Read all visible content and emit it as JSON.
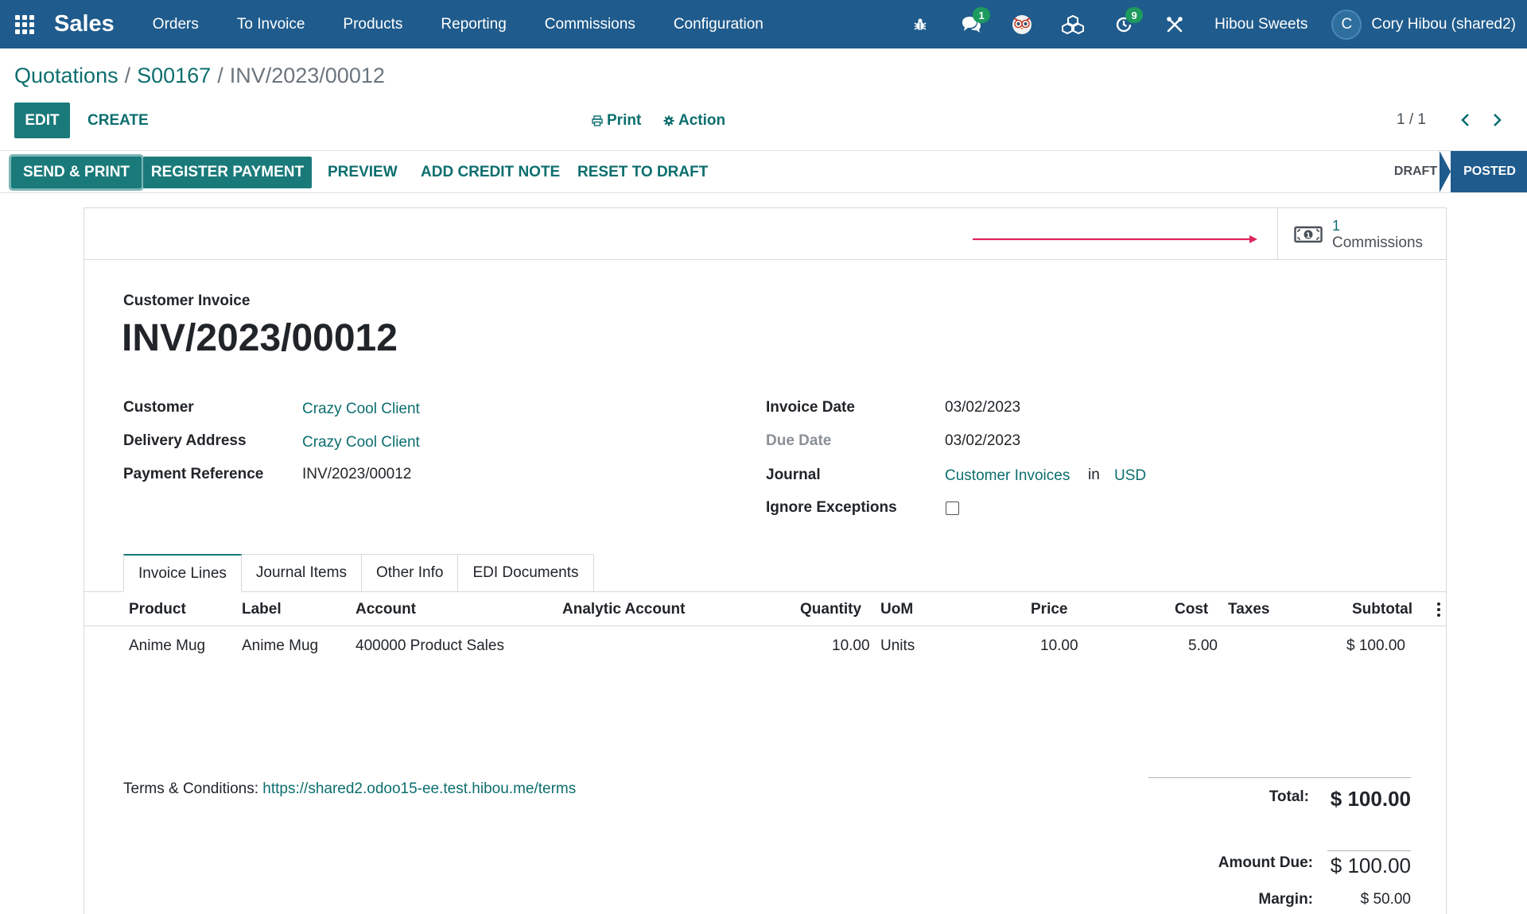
{
  "navbar": {
    "app_name": "Sales",
    "menu": [
      "Orders",
      "To Invoice",
      "Products",
      "Reporting",
      "Commissions",
      "Configuration"
    ],
    "chat_badge": "1",
    "activity_badge": "9",
    "company": "Hibou Sweets",
    "user_initial": "C",
    "user_name": "Cory Hibou (shared2)",
    "icons": [
      "apps-grid-icon",
      "bug-icon",
      "chat-icon",
      "owl-icon",
      "cubes-icon",
      "activity-clock-icon",
      "tools-icon"
    ]
  },
  "breadcrumb": {
    "items": [
      "Quotations",
      "S00167"
    ],
    "current": "INV/2023/00012"
  },
  "control": {
    "edit_label": "EDIT",
    "create_label": "CREATE",
    "print_label": "Print",
    "action_label": "Action",
    "pager": "1 / 1"
  },
  "statusbar": {
    "buttons": [
      "SEND & PRINT",
      "REGISTER PAYMENT",
      "PREVIEW",
      "ADD CREDIT NOTE",
      "RESET TO DRAFT"
    ],
    "states": [
      "DRAFT",
      "POSTED"
    ],
    "active_state": "POSTED"
  },
  "smart_button": {
    "value": "1",
    "label": "Commissions",
    "icon": "money-icon"
  },
  "invoice": {
    "type": "Customer Invoice",
    "name": "INV/2023/00012",
    "customer_label": "Customer",
    "customer": "Crazy Cool Client",
    "delivery_label": "Delivery Address",
    "delivery": "Crazy Cool Client",
    "payref_label": "Payment Reference",
    "payref": "INV/2023/00012",
    "invoice_date_label": "Invoice Date",
    "invoice_date": "03/02/2023",
    "due_date_label": "Due Date",
    "due_date": "03/02/2023",
    "journal_label": "Journal",
    "journal": "Customer Invoices",
    "journal_in": "in",
    "currency": "USD",
    "ignore_exceptions_label": "Ignore Exceptions"
  },
  "tabs": [
    "Invoice Lines",
    "Journal Items",
    "Other Info",
    "EDI Documents"
  ],
  "lines": {
    "columns": [
      "Product",
      "Label",
      "Account",
      "Analytic Account",
      "Quantity",
      "UoM",
      "Price",
      "Cost",
      "Taxes",
      "Subtotal"
    ],
    "rows": [
      [
        "Anime Mug",
        "Anime Mug",
        "400000 Product Sales",
        "",
        "10.00",
        "Units",
        "10.00",
        "5.00",
        "",
        "$ 100.00"
      ]
    ]
  },
  "terms": {
    "label": "Terms & Conditions: ",
    "link": "https://shared2.odoo15-ee.test.hibou.me/terms"
  },
  "totals": {
    "total_label": "Total:",
    "total": "$ 100.00",
    "amount_due_label": "Amount Due:",
    "amount_due": "$ 100.00",
    "margin_label": "Margin:",
    "margin": "$ 50.00"
  },
  "colors": {
    "navbar": "#1f5b8c",
    "primary": "#1a7a7a",
    "link": "#0d6e6e",
    "annotation_arrow": "#e0245e"
  }
}
